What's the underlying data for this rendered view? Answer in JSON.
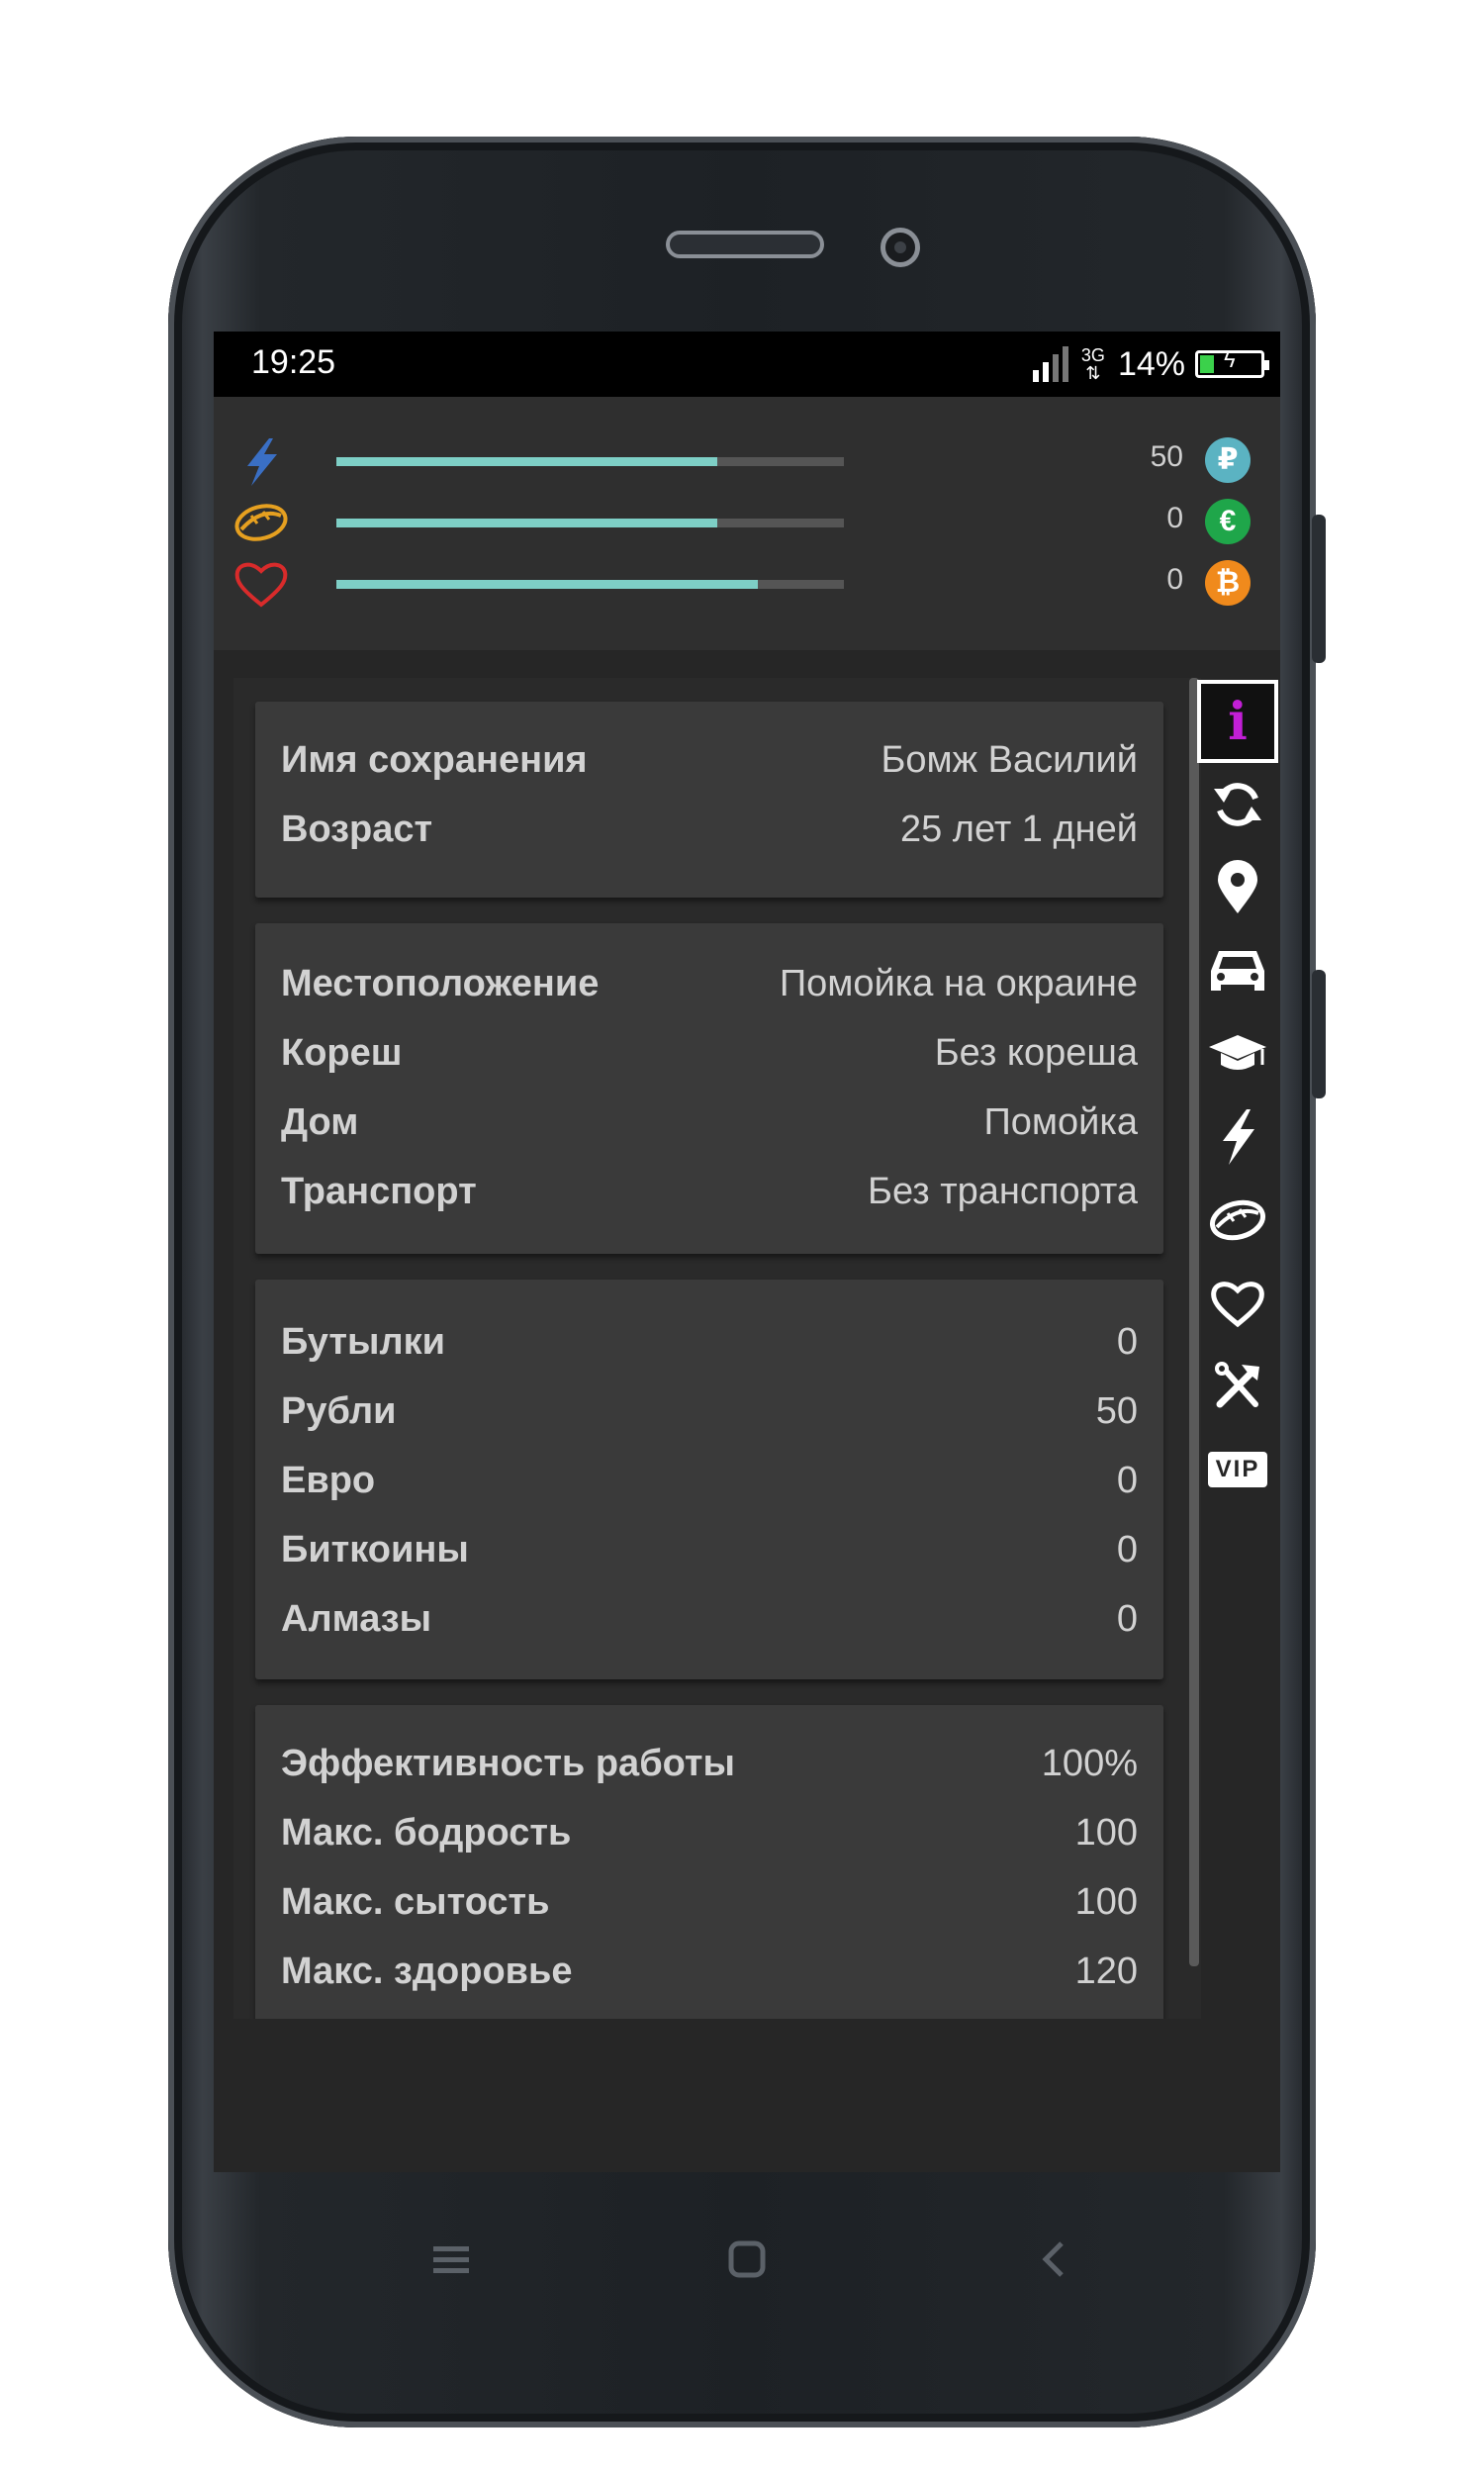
{
  "status_bar": {
    "time": "19:25",
    "network": "3G",
    "battery": "14%"
  },
  "stats": [
    {
      "name": "energy",
      "icon": "lightning-icon",
      "level_percent": 75,
      "color": "#3a6fc4"
    },
    {
      "name": "satiety",
      "icon": "food-icon",
      "level_percent": 75,
      "color": "#e6a020"
    },
    {
      "name": "health",
      "icon": "heart-icon",
      "level_percent": 83,
      "color": "#d92b2b"
    }
  ],
  "currencies": [
    {
      "value": "50",
      "symbol": "₽",
      "icon": "ruble-coin-icon",
      "color": "#5bb3c2"
    },
    {
      "value": "0",
      "symbol": "€",
      "icon": "euro-coin-icon",
      "color": "#1fa64a"
    },
    {
      "value": "0",
      "symbol": "₿",
      "icon": "bitcoin-coin-icon",
      "color": "#f08a1c"
    }
  ],
  "cards": [
    {
      "rows": [
        {
          "label": "Имя сохранения",
          "value": "Бомж Василий"
        },
        {
          "label": "Возраст",
          "value": "25 лет 1 дней"
        }
      ]
    },
    {
      "rows": [
        {
          "label": "Местоположение",
          "value": "Помойка на окраине"
        },
        {
          "label": "Кореш",
          "value": "Без кореша"
        },
        {
          "label": "Дом",
          "value": "Помойка"
        },
        {
          "label": "Транспорт",
          "value": "Без транспорта"
        }
      ]
    },
    {
      "rows": [
        {
          "label": "Бутылки",
          "value": "0"
        },
        {
          "label": "Рубли",
          "value": "50"
        },
        {
          "label": "Евро",
          "value": "0"
        },
        {
          "label": "Биткоины",
          "value": "0"
        },
        {
          "label": "Алмазы",
          "value": "0"
        }
      ]
    },
    {
      "rows": [
        {
          "label": "Эффективность работы",
          "value": "100%"
        },
        {
          "label": "Макс. бодрость",
          "value": "100"
        },
        {
          "label": "Макс. сытость",
          "value": "100"
        },
        {
          "label": "Макс. здоровье",
          "value": "120"
        }
      ]
    }
  ],
  "sidebar": {
    "items": [
      {
        "name": "info-icon",
        "glyph": "i",
        "active": true,
        "color": "#c21fd6"
      },
      {
        "name": "refresh-icon"
      },
      {
        "name": "location-pin-icon"
      },
      {
        "name": "car-icon"
      },
      {
        "name": "graduation-cap-icon"
      },
      {
        "name": "lightning-icon"
      },
      {
        "name": "food-icon"
      },
      {
        "name": "heart-icon"
      },
      {
        "name": "tools-icon"
      },
      {
        "name": "vip-icon",
        "glyph": "VIP"
      }
    ]
  },
  "navbar": [
    "menu-icon",
    "home-icon",
    "back-icon"
  ]
}
